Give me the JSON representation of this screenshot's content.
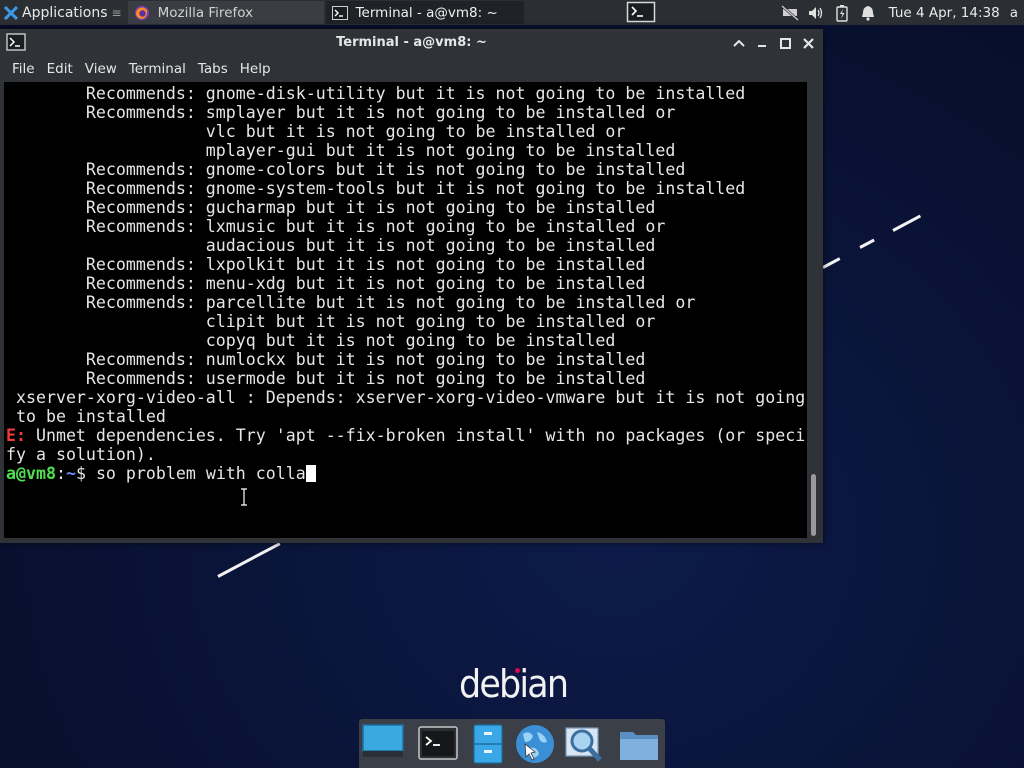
{
  "top_panel": {
    "applications_label": "Applications",
    "tasks": [
      {
        "label": "Mozilla Firefox",
        "icon": "firefox-icon"
      },
      {
        "label": "Terminal - a@vm8: ~",
        "icon": "terminal-icon"
      }
    ],
    "clock": "Tue  4 Apr, 14:38",
    "user": "a"
  },
  "window": {
    "title": "Terminal - a@vm8: ~",
    "menu": [
      "File",
      "Edit",
      "View",
      "Terminal",
      "Tabs",
      "Help"
    ]
  },
  "terminal": {
    "lines": [
      "        Recommends: gnome-disk-utility but it is not going to be installed",
      "        Recommends: smplayer but it is not going to be installed or",
      "                    vlc but it is not going to be installed or",
      "                    mplayer-gui but it is not going to be installed",
      "        Recommends: gnome-colors but it is not going to be installed",
      "        Recommends: gnome-system-tools but it is not going to be installed",
      "        Recommends: gucharmap but it is not going to be installed",
      "        Recommends: lxmusic but it is not going to be installed or",
      "                    audacious but it is not going to be installed",
      "        Recommends: lxpolkit but it is not going to be installed",
      "        Recommends: menu-xdg but it is not going to be installed",
      "        Recommends: parcellite but it is not going to be installed or",
      "                    clipit but it is not going to be installed or",
      "                    copyq but it is not going to be installed",
      "        Recommends: numlockx but it is not going to be installed",
      "        Recommends: usermode but it is not going to be installed",
      " xserver-xorg-video-all : Depends: xserver-xorg-video-vmware but it is not going",
      " to be installed"
    ],
    "error_prefix": "E:",
    "error_line1": " Unmet dependencies. Try 'apt --fix-broken install' with no packages (or speci",
    "error_line2": "fy a solution).",
    "prompt_user": "a@vm8",
    "prompt_colon": ":",
    "prompt_path": "~",
    "prompt_symbol": "$ ",
    "input": "so problem with colla"
  },
  "desktop": {
    "logo_text": "debian",
    "logo_dot_color": "#d70751",
    "dock_items": [
      "show-desktop-icon",
      "terminal-icon",
      "file-cabinet-icon",
      "web-browser-icon",
      "app-finder-icon",
      "folder-icon"
    ]
  }
}
